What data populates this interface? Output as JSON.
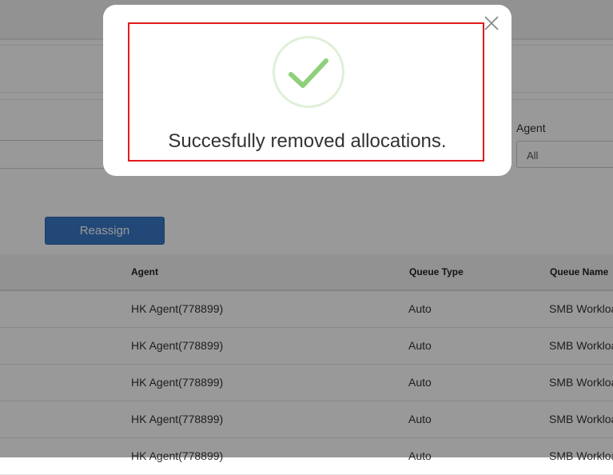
{
  "filters": {
    "agent_label": "Agent",
    "agent_value": "All"
  },
  "actions": {
    "reassign_label": "Reassign"
  },
  "table": {
    "headers": [
      "Agent",
      "Queue Type",
      "Queue Name"
    ],
    "rows": [
      {
        "agent": "HK Agent(778899)",
        "queue_type": "Auto",
        "queue_name": "SMB Workloa"
      },
      {
        "agent": "HK Agent(778899)",
        "queue_type": "Auto",
        "queue_name": "SMB Workloa"
      },
      {
        "agent": "HK Agent(778899)",
        "queue_type": "Auto",
        "queue_name": "SMB Workloa"
      },
      {
        "agent": "HK Agent(778899)",
        "queue_type": "Auto",
        "queue_name": "SMB Workloa"
      },
      {
        "agent": "HK Agent(778899)",
        "queue_type": "Auto",
        "queue_name": "SMB Workloa"
      }
    ]
  },
  "dialog": {
    "message": "Succesfully removed allocations.",
    "icon": "check-circle-icon",
    "close_icon": "close-icon"
  },
  "colors": {
    "primary_button": "#3a78c9",
    "success_check": "#8fd07a",
    "highlight_border": "#e21b1b"
  }
}
